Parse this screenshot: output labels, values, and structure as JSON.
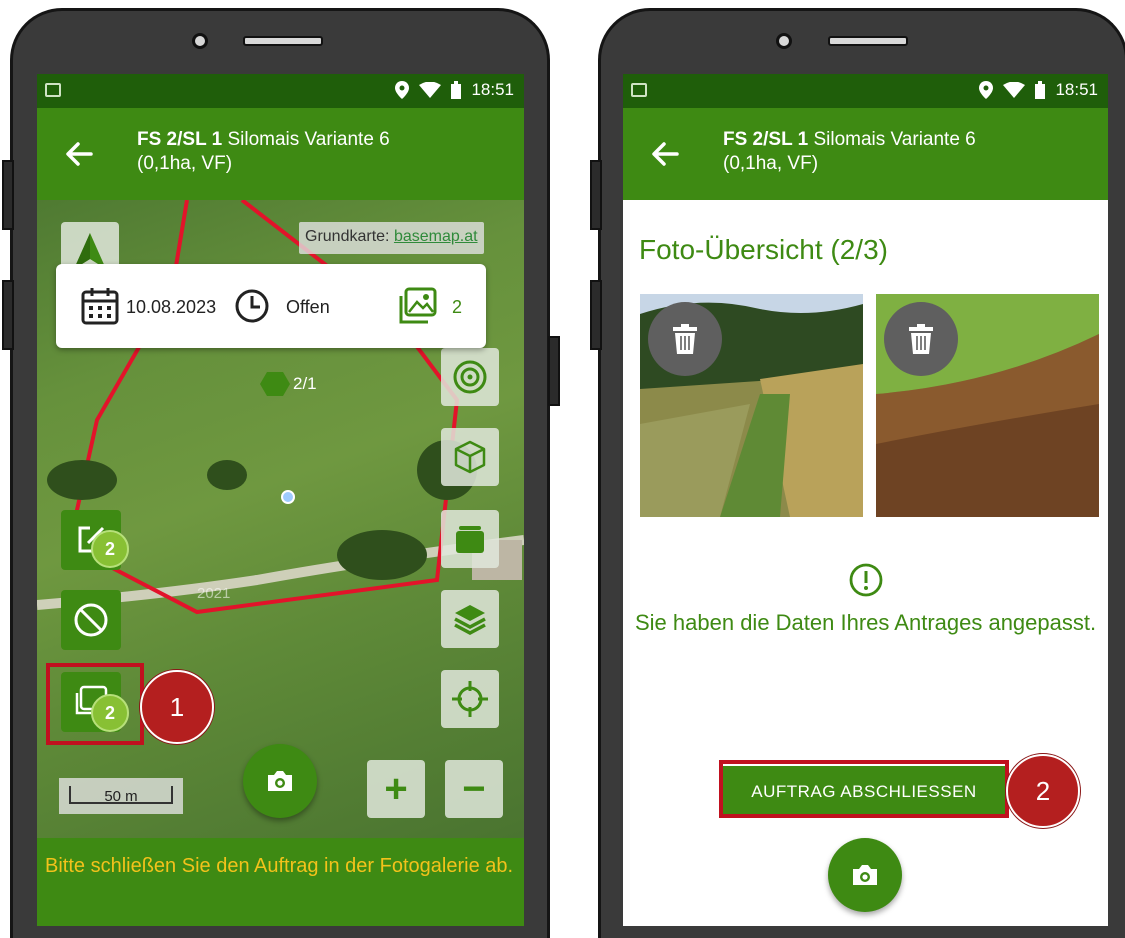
{
  "left": {
    "status": {
      "time": "18:51"
    },
    "appbar": {
      "title_bold": "FS 2/SL 1",
      "title_rest": " Silomais Variante 6",
      "subtitle": "(0,1ha,  VF)"
    },
    "map": {
      "attribution_label": "Grundkarte: ",
      "attribution_link": "basemap.at",
      "field_label": "2/1",
      "year_label": "2021",
      "scale_label": "50 m"
    },
    "info_card": {
      "date": "10.08.2023",
      "status": "Offen",
      "photo_count": "2"
    },
    "badges": {
      "edit": "2",
      "gallery": "2"
    },
    "zoom_in": "+",
    "zoom_out": "−",
    "banner": "Bitte schließen Sie den Auftrag in der Fotogalerie ab.",
    "annotation": "1"
  },
  "right": {
    "status": {
      "time": "18:51"
    },
    "appbar": {
      "title_bold": "FS 2/SL 1",
      "title_rest": " Silomais Variante 6",
      "subtitle": "(0,1ha,  VF)"
    },
    "heading": "Foto-Übersicht (2/3)",
    "message": "Sie haben die Daten Ihres Antrages angepasst.",
    "button": "AUFTRAG ABSCHLIESSEN",
    "annotation": "2"
  },
  "colors": {
    "brand": "#3e8a13",
    "status_bar": "#1f5e0a",
    "accent_red": "#c0111f",
    "warning_text": "#f3c21b"
  },
  "icons": [
    "arrow-left-icon",
    "image-icon",
    "location-pin-icon",
    "wifi-icon",
    "battery-icon",
    "calendar-icon",
    "clock-icon",
    "gallery-icon",
    "navigation-arrow-icon",
    "target-icon",
    "cube-icon",
    "layers-icon",
    "stack-icon",
    "crosshair-icon",
    "edit-icon",
    "forbidden-icon",
    "camera-icon",
    "trash-icon",
    "exclamation-icon"
  ]
}
